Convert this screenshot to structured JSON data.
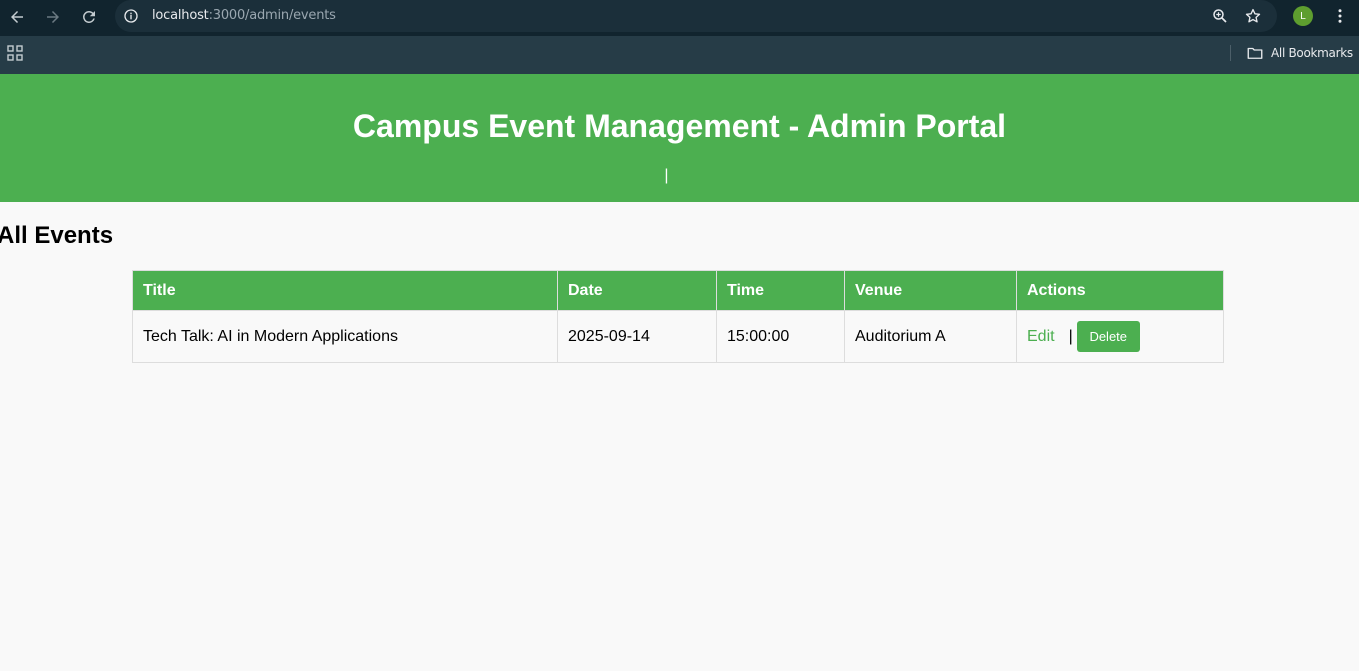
{
  "browser": {
    "url_host": "localhost",
    "url_rest": ":3000/admin/events",
    "avatar_initial": "L",
    "bookmarks_label": "All Bookmarks"
  },
  "header": {
    "title": "Campus Event Management - Admin Portal",
    "nav_separator": "|"
  },
  "main": {
    "section_title": "All Events",
    "table": {
      "columns": [
        "Title",
        "Date",
        "Time",
        "Venue",
        "Actions"
      ],
      "rows": [
        {
          "title": "Tech Talk: AI in Modern Applications",
          "date": "2025-09-14",
          "time": "15:00:00",
          "venue": "Auditorium A",
          "edit_label": "Edit",
          "separator": "|",
          "delete_label": "Delete"
        }
      ]
    }
  },
  "colors": {
    "accent": "#4caf50",
    "chrome_dark": "#11242e",
    "bookmarks_bar": "#263c47",
    "page_bg": "#f9f9f9"
  }
}
